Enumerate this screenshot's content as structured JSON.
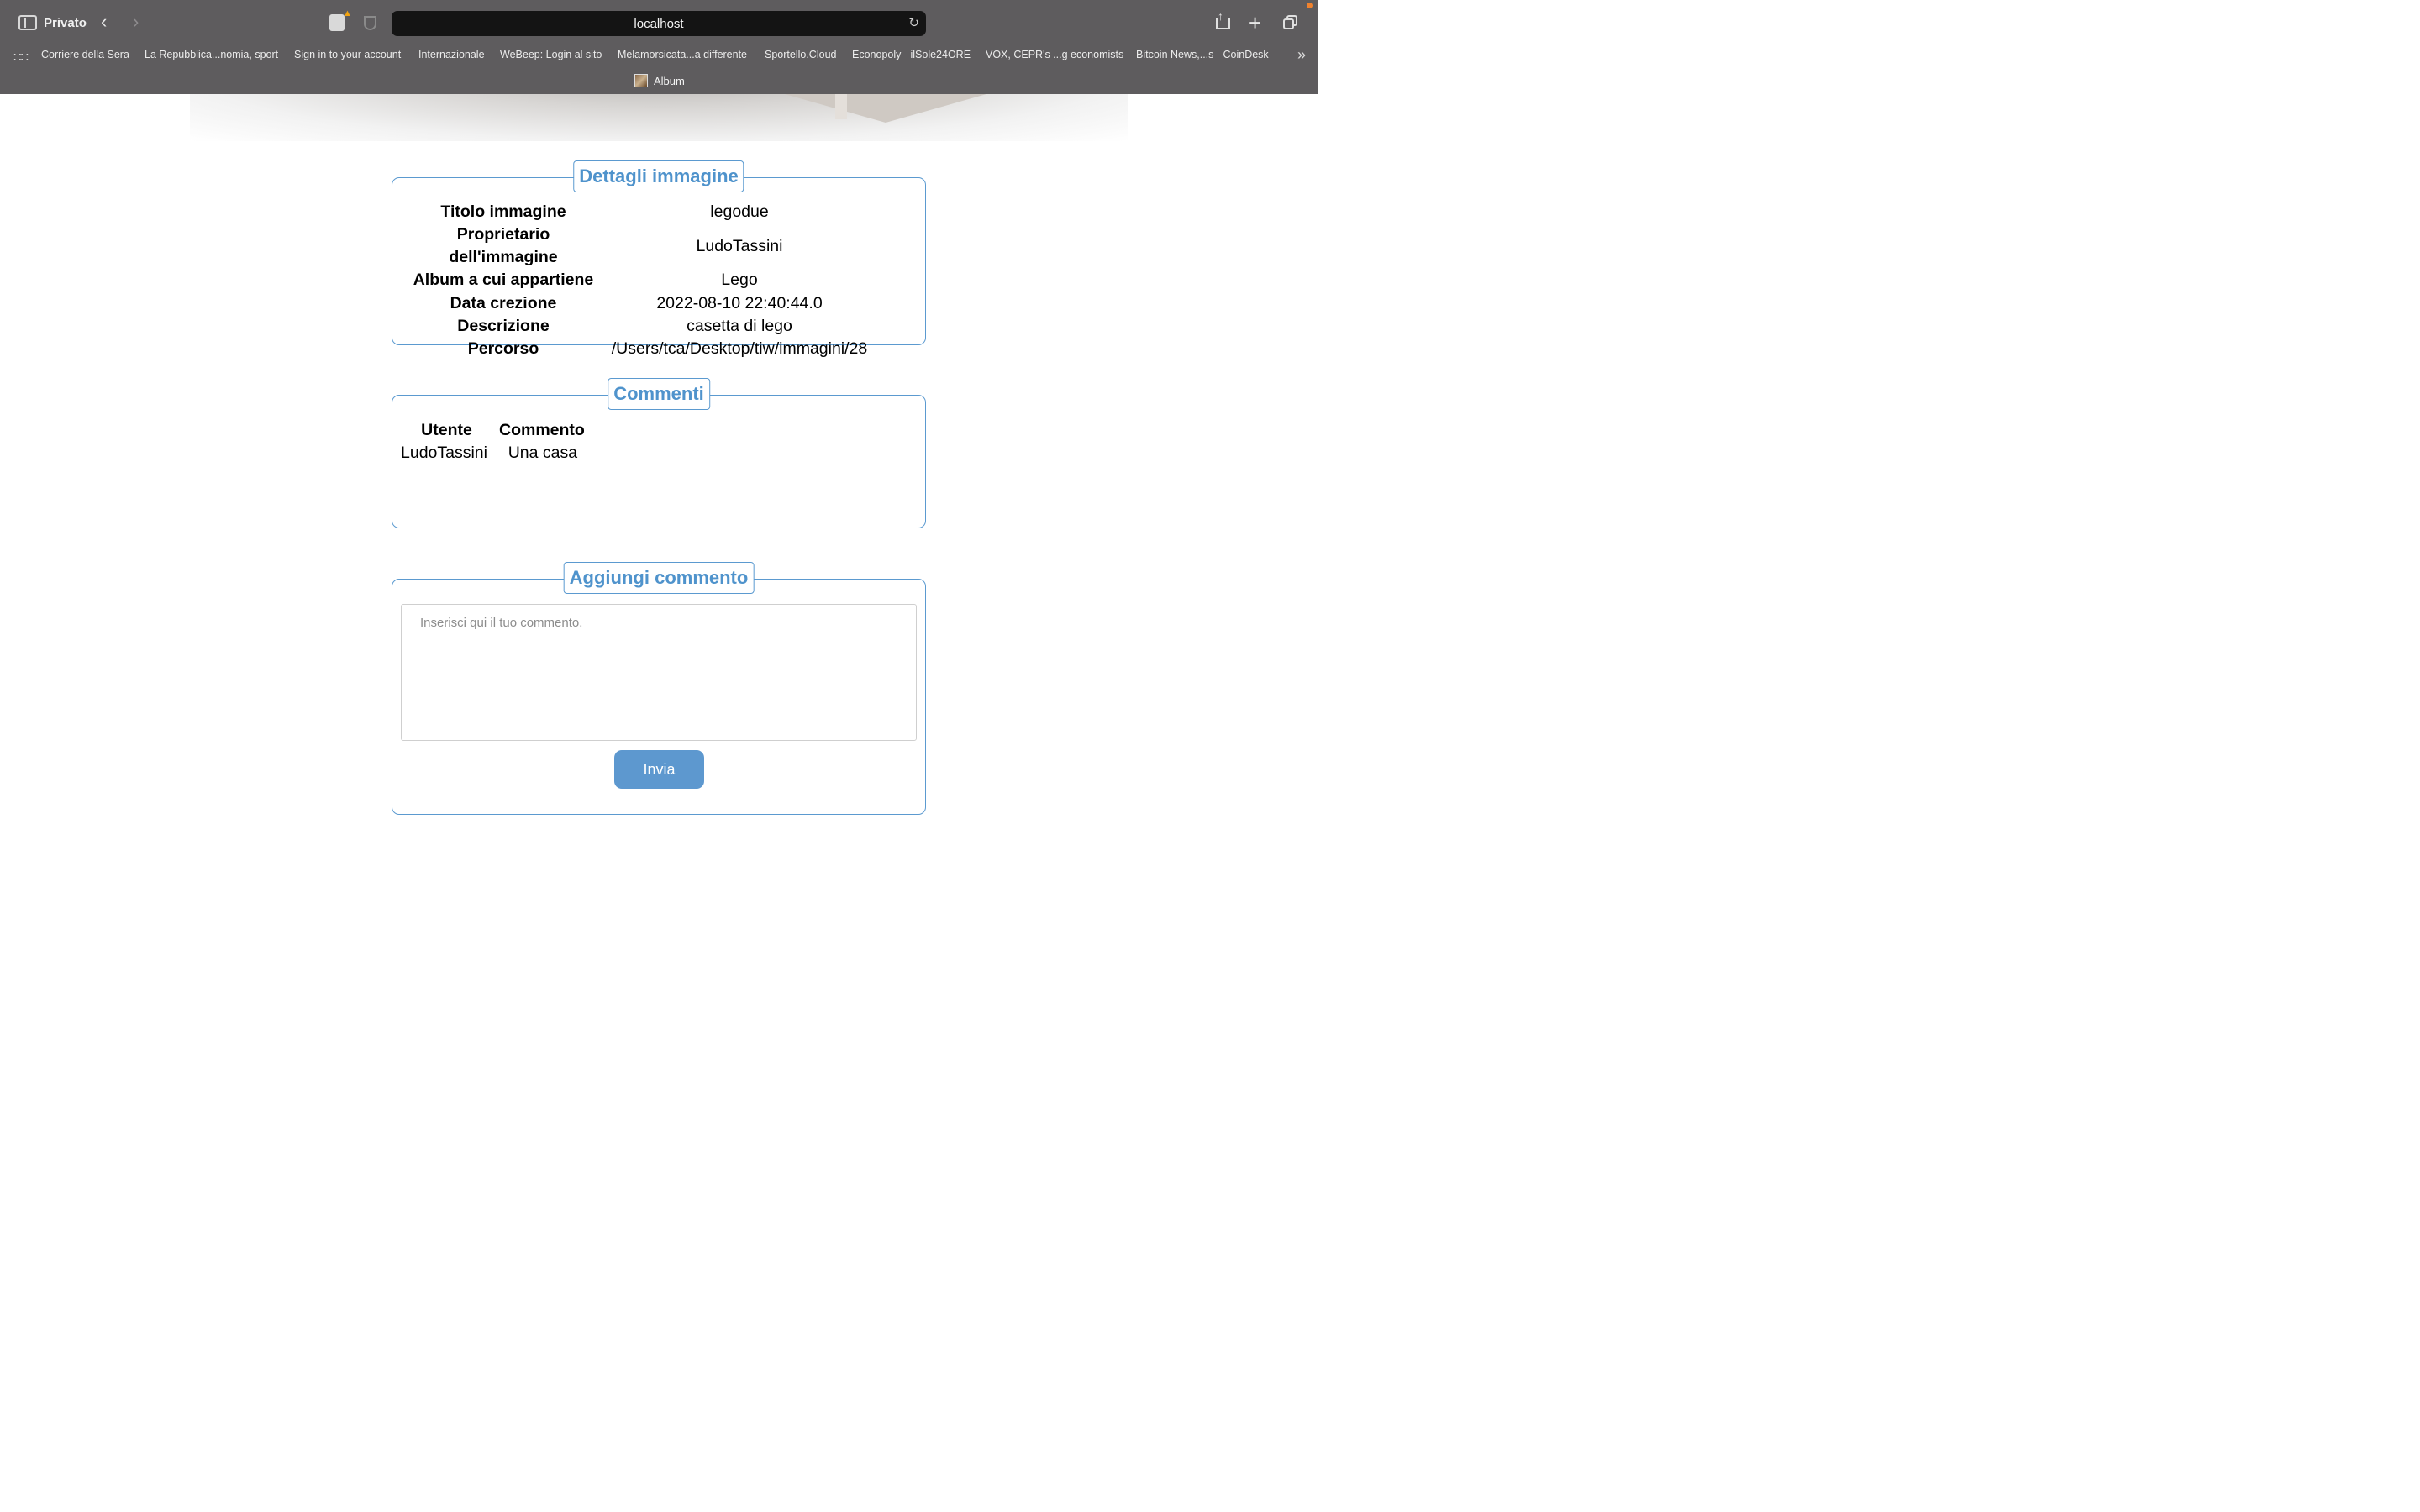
{
  "browser": {
    "private_label": "Privato",
    "url": "localhost",
    "active_tab": "Album",
    "bookmarks": [
      "Corriere della Sera",
      "La Repubblica...nomia, sport",
      "Sign in to your account",
      "Internazionale",
      "WeBeep: Login al sito",
      "Melamorsicata...a differente",
      "Sportello.Cloud",
      "Econopoly - ilSole24ORE",
      "VOX, CEPR's ...g economists",
      "Bitcoin News,...s - CoinDesk"
    ]
  },
  "details": {
    "legend": "Dettagli immagine",
    "rows": [
      {
        "label": "Titolo immagine",
        "value": "legodue"
      },
      {
        "label": "Proprietario dell'immagine",
        "value": "LudoTassini"
      },
      {
        "label": "Album a cui appartiene",
        "value": "Lego"
      },
      {
        "label": "Data crezione",
        "value": "2022-08-10 22:40:44.0"
      },
      {
        "label": "Descrizione",
        "value": "casetta di lego"
      },
      {
        "label": "Percorso",
        "value": "/Users/tca/Desktop/tiw/immagini/28"
      }
    ]
  },
  "comments": {
    "legend": "Commenti",
    "headers": {
      "user": "Utente",
      "comment": "Commento"
    },
    "rows": [
      {
        "user": "LudoTassini",
        "comment": "Una casa"
      }
    ]
  },
  "add_comment": {
    "legend": "Aggiungi commento",
    "placeholder": "Inserisci qui il tuo commento.",
    "submit_label": "Invia"
  }
}
